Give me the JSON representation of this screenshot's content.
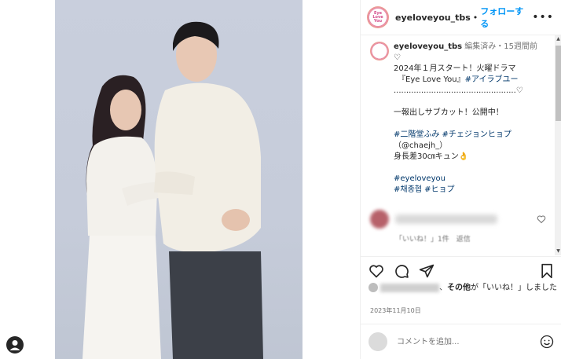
{
  "post": {
    "username": "eyeloveyou_tbs",
    "follow_label": "フォローする",
    "dot": "•",
    "more_label": "•••",
    "avatar_text": "Eye Love You"
  },
  "caption": {
    "username": "eyeloveyou_tbs",
    "meta": "編集済み・15週間前",
    "line1": "♡\n2024年１月スタート！火曜ドラマ\n　『Eye Love You』",
    "tag1": "#アイラブユー",
    "line2": "\n.................................................♡\n\n一報出しサブカット！公開中！\n\n",
    "tag2": "#二階堂ふみ #チェジョンヒョプ",
    "line3": "\n（@chaejh_）\n身長差30㎝キュン👌\n\n",
    "tag3": "#eyeloveyou\n#채종협 #ヒョプ"
  },
  "reply_meta": "「いいね！」1件　返信",
  "likes": {
    "prefix": "、",
    "bold": "その他",
    "suffix": "が「いいね！」しました"
  },
  "date": "2023年11月10日",
  "comment_input": {
    "placeholder": "コメントを追加..."
  },
  "colors": {
    "accent": "#0095f6",
    "hashtag": "#00376b"
  }
}
